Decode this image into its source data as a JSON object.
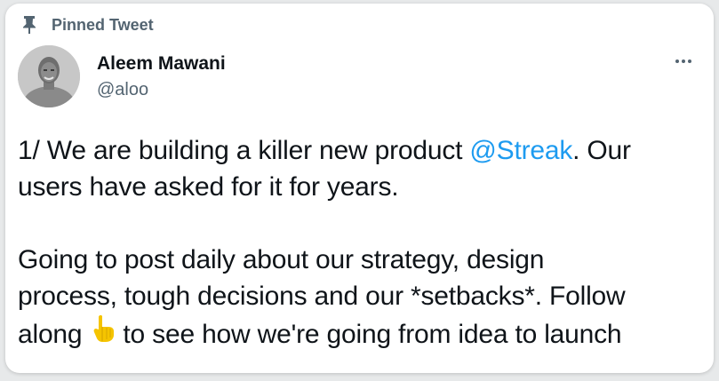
{
  "pinned": {
    "label": "Pinned Tweet",
    "icon": "pin-icon"
  },
  "author": {
    "name": "Aleem Mawani",
    "handle": "@aloo",
    "avatar_icon": "avatar"
  },
  "menu": {
    "icon": "more-options-icon"
  },
  "tweet": {
    "line1_prefix": "1/ We are building a killer new product ",
    "mention": "@Streak",
    "line1_suffix": ". Our",
    "line2": "users have asked for it for years.",
    "line3": "Going to post daily about our strategy, design",
    "line4": "process, tough decisions and our *setbacks*. Follow",
    "line5_prefix": "along",
    "emoji": "👇",
    "line5_suffix": "to see how we're going from idea to launch"
  },
  "colors": {
    "accent": "#1d9bf0",
    "text": "#0f1419",
    "secondary": "#536471",
    "emoji": "#f5c400"
  }
}
